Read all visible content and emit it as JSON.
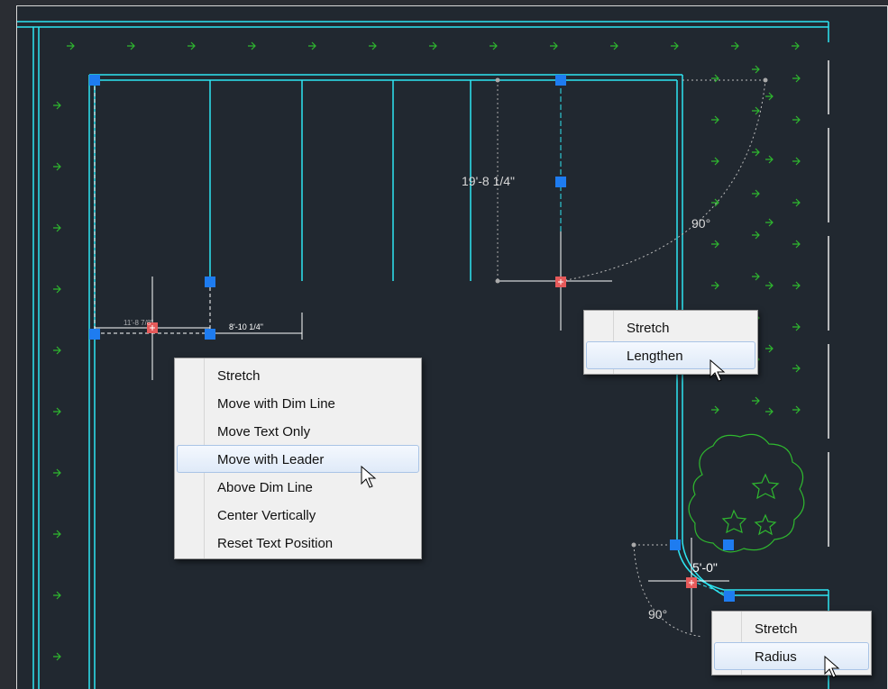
{
  "drawing": {
    "dimension_label": "19'-8 1/4\"",
    "small_dimension_label": "8'-10 1/4\"",
    "small_dimension_label_left": "11'-8 7/8\"",
    "angle_upper": "90°",
    "angle_lower": "90°",
    "radius_label": "5'-0\""
  },
  "menus": {
    "dim_text_menu": {
      "items": [
        {
          "label": "Stretch"
        },
        {
          "label": "Move with Dim Line"
        },
        {
          "label": "Move Text Only"
        },
        {
          "label": "Move with Leader",
          "highlighted": true
        },
        {
          "label": "Above Dim Line"
        },
        {
          "label": "Center Vertically"
        },
        {
          "label": "Reset Text Position"
        }
      ]
    },
    "arc_grip_menu": {
      "items": [
        {
          "label": "Stretch"
        },
        {
          "label": "Lengthen",
          "highlighted": true
        }
      ]
    },
    "radius_grip_menu": {
      "items": [
        {
          "label": "Stretch"
        },
        {
          "label": "Radius",
          "highlighted": true
        }
      ]
    }
  },
  "colors": {
    "background": "#212830",
    "geometry": "#2ee6f2",
    "grip": "#1e7cf0",
    "hot_grip": "#e65a5a",
    "hatch": "#2fb82f",
    "dimension": "#ffffff"
  }
}
